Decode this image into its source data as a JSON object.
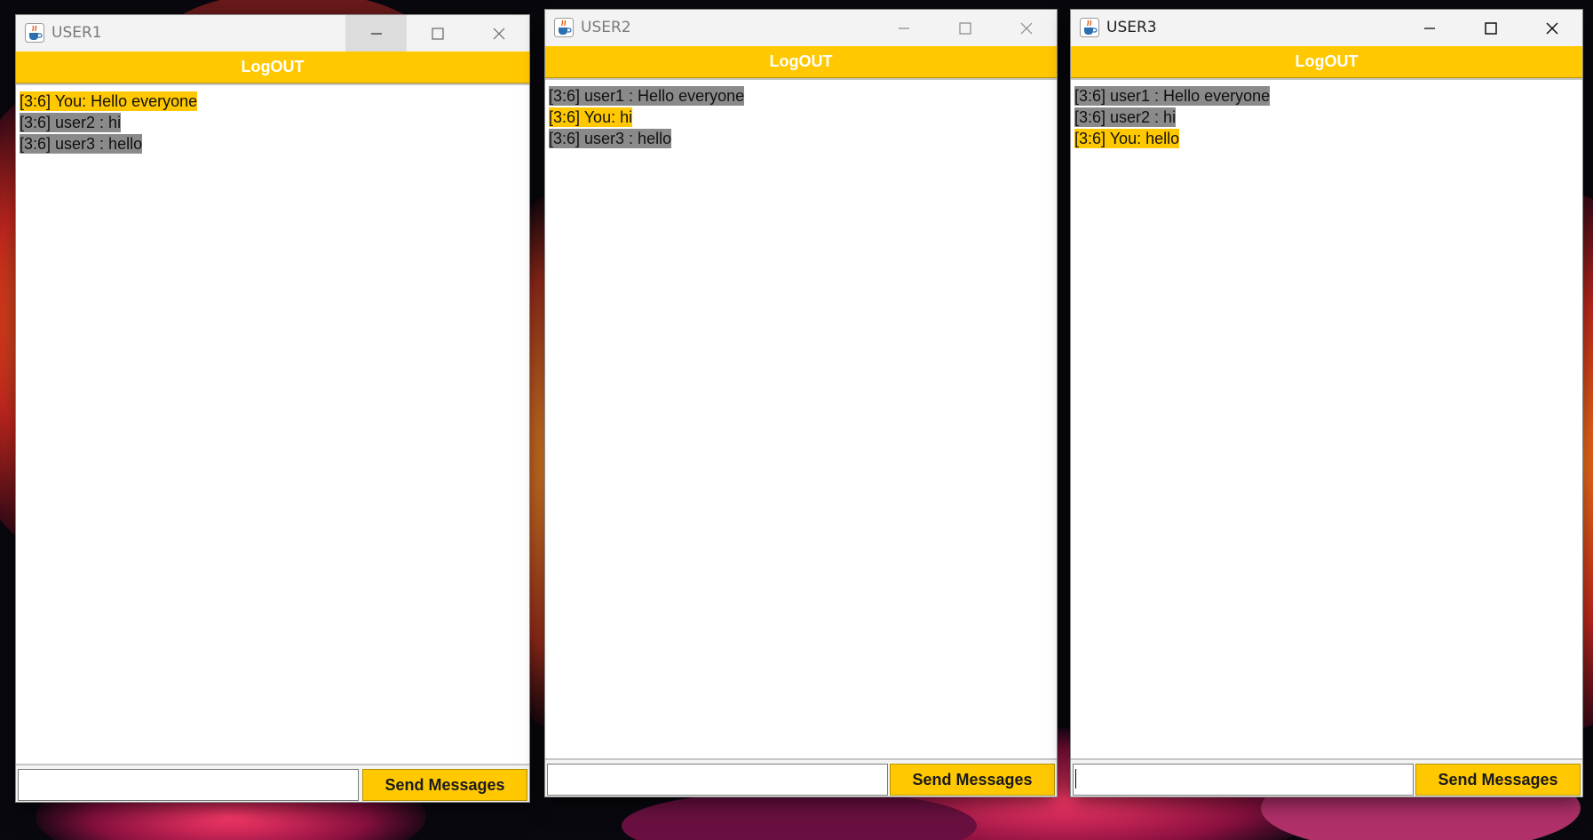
{
  "windows": [
    {
      "title": "USER1",
      "active": false,
      "logout_label": "LogOUT",
      "messages": [
        {
          "text": "[3:6] You: Hello everyone",
          "own": true
        },
        {
          "text": "[3:6] user2 : hi",
          "own": false
        },
        {
          "text": "[3:6] user3 : hello",
          "own": false
        }
      ],
      "input_value": "",
      "send_label": "Send Messages"
    },
    {
      "title": "USER2",
      "active": false,
      "logout_label": "LogOUT",
      "messages": [
        {
          "text": "[3:6] user1 : Hello everyone",
          "own": false
        },
        {
          "text": "[3:6] You: hi",
          "own": true
        },
        {
          "text": "[3:6] user3 : hello",
          "own": false
        }
      ],
      "input_value": "",
      "send_label": "Send Messages"
    },
    {
      "title": "USER3",
      "active": true,
      "logout_label": "LogOUT",
      "messages": [
        {
          "text": "[3:6] user1 : Hello everyone",
          "own": false
        },
        {
          "text": "[3:6] user2 : hi",
          "own": false
        },
        {
          "text": "[3:6] You: hello",
          "own": true
        }
      ],
      "input_value": "",
      "send_label": "Send Messages"
    }
  ],
  "colors": {
    "accent": "#ffc800",
    "own_message_bg": "#ffc800",
    "other_message_bg": "#8a8a8a",
    "logout_text": "#ffffff",
    "titlebar_bg": "#f3f3f3"
  },
  "icons": {
    "app": "java-cup-icon",
    "minimize": "minimize-icon",
    "maximize": "maximize-icon",
    "close": "close-icon"
  }
}
